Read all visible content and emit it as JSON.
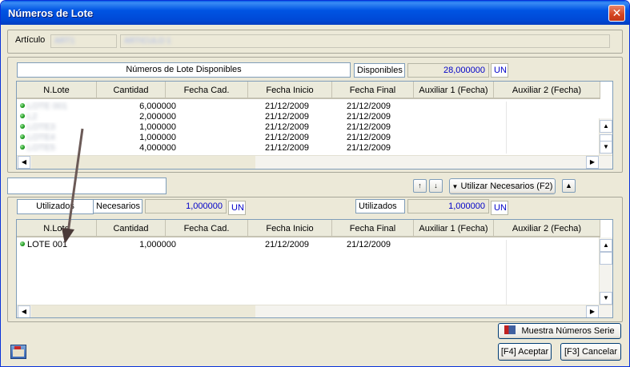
{
  "window": {
    "title": "Números de Lote",
    "close": "✕"
  },
  "articulo": {
    "label": "Artículo",
    "code": "ART1",
    "description": "ARTICULO 1"
  },
  "available": {
    "title": "Números de Lote Disponibles",
    "disponibles_label": "Disponibles",
    "disponibles_value": "28,000000",
    "unit": "UN",
    "columns": [
      "N.Lote",
      "Cantidad",
      "Fecha Cad.",
      "Fecha Inicio",
      "Fecha Final",
      "Auxiliar 1 (Fecha)",
      "Auxiliar 2 (Fecha)"
    ],
    "rows": [
      {
        "lote": "LOTE 001",
        "cantidad": "6,000000",
        "fecha_cad": "",
        "fecha_inicio": "21/12/2009",
        "fecha_final": "21/12/2009"
      },
      {
        "lote": "L2",
        "cantidad": "2,000000",
        "fecha_cad": "",
        "fecha_inicio": "21/12/2009",
        "fecha_final": "21/12/2009"
      },
      {
        "lote": "LOTE3",
        "cantidad": "1,000000",
        "fecha_cad": "",
        "fecha_inicio": "21/12/2009",
        "fecha_final": "21/12/2009"
      },
      {
        "lote": "LOTE4",
        "cantidad": "1,000000",
        "fecha_cad": "",
        "fecha_inicio": "21/12/2009",
        "fecha_final": "21/12/2009"
      },
      {
        "lote": "LOTE5",
        "cantidad": "4,000000",
        "fecha_cad": "",
        "fecha_inicio": "21/12/2009",
        "fecha_final": "21/12/2009"
      }
    ]
  },
  "middle": {
    "search_value": "",
    "up": "↑",
    "down": "↓",
    "usar_button": "Utilizar Necesarios (F2)"
  },
  "used": {
    "utilizados_tab": "Utilizados",
    "necesarios_label": "Necesarios",
    "necesarios_value": "1,000000",
    "unit": "UN",
    "utilizados_label": "Utilizados",
    "utilizados_value": "1,000000",
    "columns": [
      "N.Lote",
      "Cantidad",
      "Fecha Cad.",
      "Fecha Inicio",
      "Fecha Final",
      "Auxiliar 1 (Fecha)",
      "Auxiliar 2 (Fecha)"
    ],
    "rows": [
      {
        "lote": "LOTE 001",
        "cantidad": "1,000000",
        "fecha_cad": "",
        "fecha_inicio": "21/12/2009",
        "fecha_final": "21/12/2009"
      }
    ]
  },
  "footer": {
    "muestra_button": "Muestra Números Serie",
    "aceptar_button": "[F4] Aceptar",
    "cancelar_button": "[F3] Cancelar"
  }
}
